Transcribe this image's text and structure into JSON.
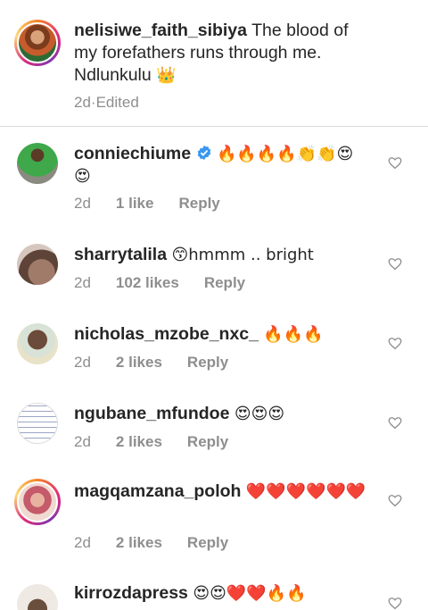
{
  "caption": {
    "username": "nelisiwe_faith_sibiya",
    "text": "The blood of my forefathers runs through me. Ndlunkulu",
    "emoji": "👑",
    "time": "2d",
    "separator": " · ",
    "edited": "Edited"
  },
  "comments": [
    {
      "username": "conniechiume",
      "verified": true,
      "text": "🔥🔥🔥🔥👏👏😍😍",
      "time": "2d",
      "likes": "1 like",
      "reply": "Reply"
    },
    {
      "username": "sharrytalila",
      "verified": false,
      "text": "😙hmmm .. bright",
      "time": "2d",
      "likes": "102 likes",
      "reply": "Reply"
    },
    {
      "username": "nicholas_mzobe_nxc_",
      "verified": false,
      "text": "🔥🔥🔥",
      "time": "2d",
      "likes": "2 likes",
      "reply": "Reply"
    },
    {
      "username": "ngubane_mfundoe",
      "verified": false,
      "text": "😍😍😍",
      "time": "2d",
      "likes": "2 likes",
      "reply": "Reply"
    },
    {
      "username": "magqamzana_poloh",
      "verified": false,
      "text": "❤️❤️❤️❤️❤️❤️",
      "time": "2d",
      "likes": "2 likes",
      "reply": "Reply"
    },
    {
      "username": "kirrozdapress",
      "verified": false,
      "text": "😍😍❤️❤️🔥🔥",
      "time": "",
      "likes": "",
      "reply": ""
    }
  ],
  "colors": {
    "text": "#262626",
    "meta": "#8e8e8e",
    "divider": "#dbdbdb",
    "verified": "#3897f0"
  },
  "icons": {
    "like": "heart-outline-icon",
    "verified": "verified-badge-icon"
  }
}
